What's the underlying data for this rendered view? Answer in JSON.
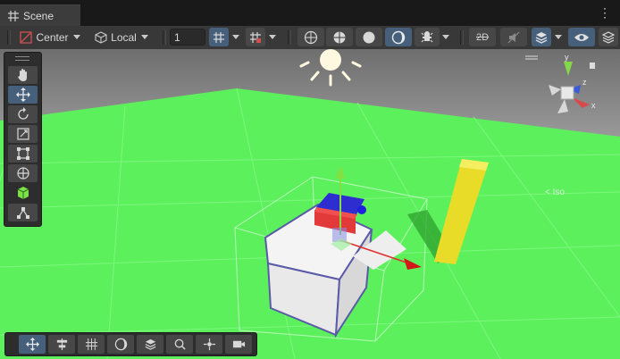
{
  "tab": {
    "title": "Scene",
    "icon": "grid-icon"
  },
  "toolbar": {
    "pivot_mode": "Center",
    "pivot_rotation": "Local",
    "grid_size": "1",
    "mode_2d": "2D",
    "icons": [
      "pivot-center-icon",
      "pivot-local-icon",
      "grid-snap-icon",
      "increment-snap-icon",
      "wireframe-shading-icon",
      "shaded-wireframe-icon",
      "shaded-icon",
      "lighting-icon",
      "fx-icon",
      "mode-2d-icon",
      "audio-mute-icon",
      "layers-icon",
      "visibility-icon"
    ]
  },
  "tools": [
    "hand-tool",
    "move-tool",
    "rotate-tool",
    "scale-tool",
    "rect-tool",
    "transform-tool",
    "custom-editor-tool",
    "snapping-tool"
  ],
  "bottom_tools": [
    "move-icon",
    "align-icon",
    "grid-icon",
    "shading-icon",
    "layers-icon",
    "search-icon",
    "pivot-icon",
    "camera-icon"
  ],
  "gizmo": {
    "y": "y",
    "z": "z",
    "x": "x",
    "projection": "< Iso"
  },
  "colors": {
    "ground": "#5ef05e",
    "sky": "#8a8a8a",
    "accent": "#46607c",
    "cube_blue": "#3030e0",
    "cube_red": "#e03030",
    "pillar": "#e8d820"
  }
}
